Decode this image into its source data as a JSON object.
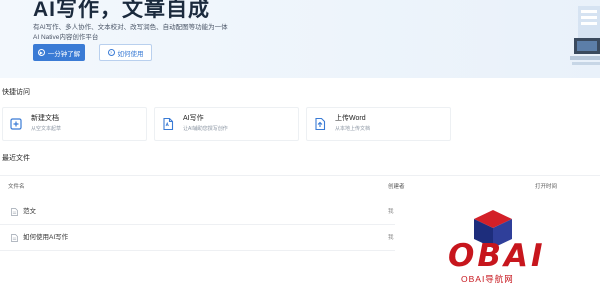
{
  "hero": {
    "title": "AI写作，文章自成",
    "subtitle": "有AI写作、多人协作、文本校对、改写润色、自动配图等功能为一体",
    "tagline": "AI Native内容创作平台",
    "primary_button": "一分钟了解",
    "secondary_button": "如何使用"
  },
  "quick_access": {
    "title": "快捷访问",
    "cards": [
      {
        "title": "新建文档",
        "desc": "从空文本起草",
        "icon": "plus-square-icon"
      },
      {
        "title": "AI写作",
        "desc": "让AI辅助您撰写创作",
        "icon": "ai-doc-icon"
      },
      {
        "title": "上传Word",
        "desc": "从本地上传文档",
        "icon": "upload-doc-icon"
      }
    ]
  },
  "recent": {
    "title": "最近文件",
    "columns": [
      "文件名",
      "创建者",
      "打开时间"
    ],
    "rows": [
      {
        "name": "范文",
        "creator": "我"
      },
      {
        "name": "如何使用AI写作",
        "creator": "我"
      }
    ]
  },
  "watermark": {
    "logo_text": "OBAI",
    "sub_text": "OBAI导航网"
  },
  "colors": {
    "accent": "#3a7bd5",
    "watermark": "#c7161d",
    "hero_bg": "#eef5fc"
  }
}
